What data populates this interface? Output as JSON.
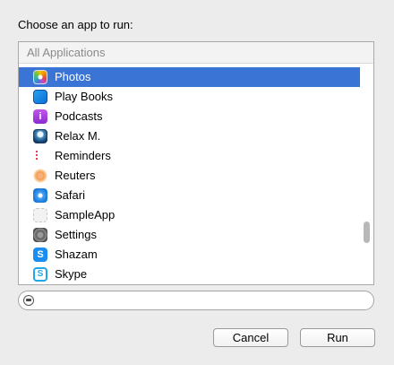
{
  "prompt": "Choose an app to run:",
  "list": {
    "header": "All Applications",
    "items": [
      {
        "label": "Photos",
        "icon": "photos-icon",
        "selected": true
      },
      {
        "label": "Play Books",
        "icon": "play-books-icon",
        "selected": false
      },
      {
        "label": "Podcasts",
        "icon": "podcasts-icon",
        "selected": false
      },
      {
        "label": "Relax M.",
        "icon": "relax-icon",
        "selected": false
      },
      {
        "label": "Reminders",
        "icon": "reminders-icon",
        "selected": false
      },
      {
        "label": "Reuters",
        "icon": "reuters-icon",
        "selected": false
      },
      {
        "label": "Safari",
        "icon": "safari-icon",
        "selected": false
      },
      {
        "label": "SampleApp",
        "icon": "sampleapp-icon",
        "selected": false
      },
      {
        "label": "Settings",
        "icon": "settings-icon",
        "selected": false
      },
      {
        "label": "Shazam",
        "icon": "shazam-icon",
        "selected": false
      },
      {
        "label": "Skype",
        "icon": "skype-icon",
        "selected": false
      }
    ]
  },
  "search": {
    "value": "",
    "placeholder": ""
  },
  "buttons": {
    "cancel": "Cancel",
    "run": "Run"
  },
  "colors": {
    "selection": "#3a75d5",
    "background": "#ececec"
  }
}
